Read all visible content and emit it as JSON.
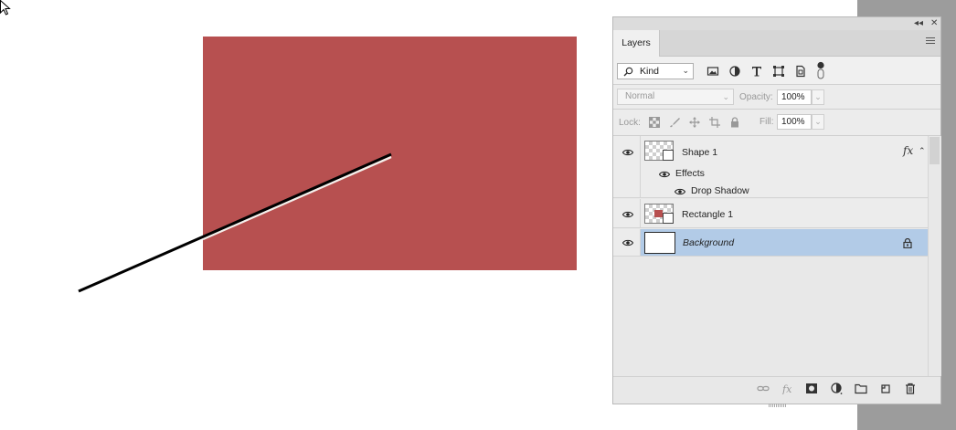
{
  "colors": {
    "rectangle_fill": "#b75050",
    "selection": "#b2cbe7",
    "pasteboard": "#9c9c9c"
  },
  "panel": {
    "tab_label": "Layers",
    "filter": {
      "kind_label": "Kind"
    },
    "blend": {
      "mode": "Normal",
      "opacity_label": "Opacity:",
      "opacity_value": "100%"
    },
    "lock": {
      "lock_label": "Lock:",
      "fill_label": "Fill:",
      "fill_value": "100%"
    },
    "layers": [
      {
        "name": "Shape 1",
        "effects_label": "Effects",
        "effect_name": "Drop Shadow",
        "fx": "fx"
      },
      {
        "name": "Rectangle 1"
      },
      {
        "name": "Background"
      }
    ]
  }
}
